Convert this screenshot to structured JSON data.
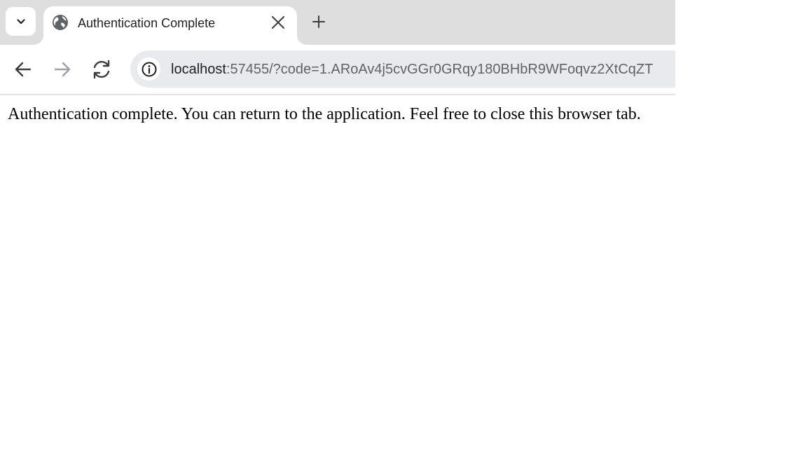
{
  "tabs": [
    {
      "title": "Authentication Complete",
      "favicon": "globe-icon",
      "active": true
    }
  ],
  "address_bar": {
    "host": "localhost",
    "path": ":57455/?code=1.ARoAv4j5cvGGr0GRqy180BHbR9WFoqvz2XtCqZT"
  },
  "page": {
    "message": "Authentication complete. You can return to the application. Feel free to close this browser tab."
  },
  "icons": {
    "tab_search": "chevron-down-icon",
    "tab_close": "close-icon",
    "new_tab": "plus-icon",
    "back": "back-arrow-icon",
    "forward": "forward-arrow-icon",
    "reload": "reload-icon",
    "site_info": "info-icon"
  },
  "colors": {
    "tabstrip_bg": "#dedede",
    "omnibox_bg": "#e9eaed",
    "icon_color": "#3c3c3c",
    "disabled_icon_color": "#9aa0a6"
  }
}
